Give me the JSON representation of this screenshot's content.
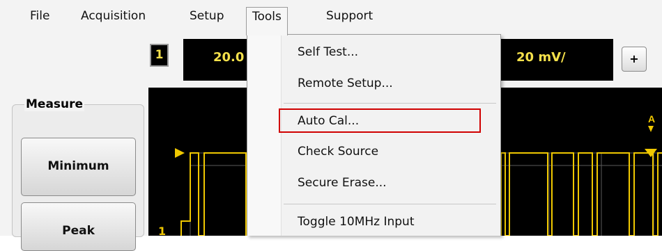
{
  "menubar": {
    "items": [
      {
        "label": "File"
      },
      {
        "label": "Acquisition"
      },
      {
        "label": "Setup"
      },
      {
        "label": "Tools"
      },
      {
        "label": "Support"
      }
    ],
    "open_menu": "Tools"
  },
  "channel": {
    "number": "1",
    "timebase_partial": "20.0",
    "scale": "20 mV/",
    "add_label": "+"
  },
  "measure": {
    "title": "Measure",
    "buttons": [
      {
        "label": "Minimum"
      },
      {
        "label": "Peak"
      }
    ]
  },
  "scope": {
    "trace_color": "#f0c800",
    "left_label": "1"
  },
  "tools_menu": {
    "items": [
      {
        "label": "Self Test..."
      },
      {
        "label": "Remote Setup..."
      },
      {
        "label": "Auto Cal..."
      },
      {
        "label": "Check Source"
      },
      {
        "label": "Secure Erase..."
      },
      {
        "label": "Toggle 10MHz Input"
      }
    ],
    "highlighted_item": "Auto Cal...",
    "highlight_color": "#d00000"
  }
}
